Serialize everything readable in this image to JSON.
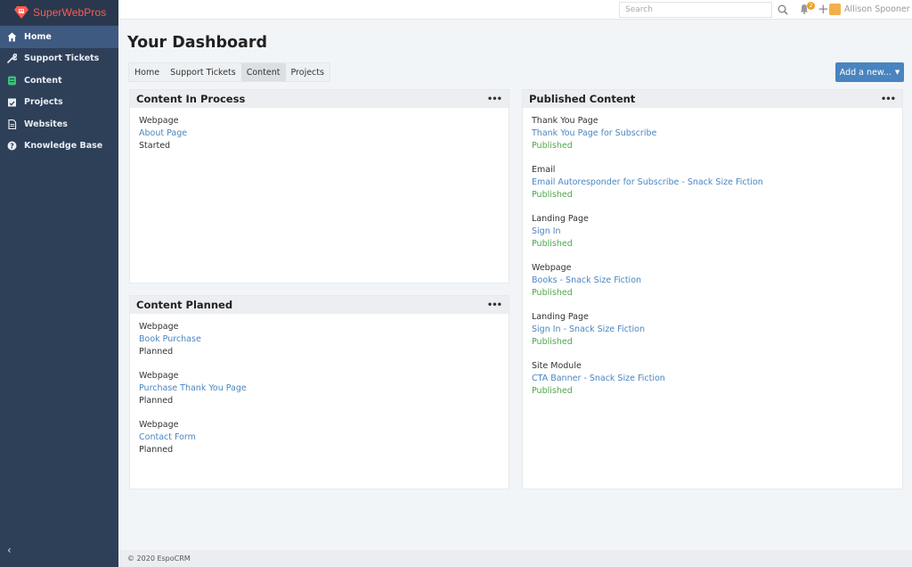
{
  "brand": {
    "name": "SuperWebPros"
  },
  "sidebar": {
    "items": [
      {
        "label": "Home",
        "icon": "home-icon"
      },
      {
        "label": "Support Tickets",
        "icon": "wrench-icon"
      },
      {
        "label": "Content",
        "icon": "content-icon"
      },
      {
        "label": "Projects",
        "icon": "calendar-check-icon"
      },
      {
        "label": "Websites",
        "icon": "document-icon"
      },
      {
        "label": "Knowledge Base",
        "icon": "question-circle-icon"
      }
    ],
    "collapse_glyph": "‹"
  },
  "topbar": {
    "search_placeholder": "Search",
    "notification_count": "2",
    "plus_glyph": "+",
    "user_name": "Allison Spooner"
  },
  "page": {
    "title": "Your Dashboard"
  },
  "tabs": [
    "Home",
    "Support Tickets",
    "Content",
    "Projects"
  ],
  "add_button": {
    "label": "Add a new...",
    "caret": "▼"
  },
  "panels": {
    "in_process": {
      "title": "Content In Process",
      "menu": "•••",
      "records": [
        {
          "type": "Webpage",
          "name": "About Page",
          "status": "Started"
        }
      ]
    },
    "planned": {
      "title": "Content Planned",
      "menu": "•••",
      "records": [
        {
          "type": "Webpage",
          "name": "Book Purchase",
          "status": "Planned"
        },
        {
          "type": "Webpage",
          "name": "Purchase Thank You Page",
          "status": "Planned"
        },
        {
          "type": "Webpage",
          "name": "Contact Form",
          "status": "Planned"
        }
      ]
    },
    "published": {
      "title": "Published Content",
      "menu": "•••",
      "records": [
        {
          "type": "Thank You Page",
          "name": "Thank You Page for Subscribe",
          "status": "Published"
        },
        {
          "type": "Email",
          "name": "Email Autoresponder for Subscribe - Snack Size Fiction",
          "status": "Published"
        },
        {
          "type": "Landing Page",
          "name": "Sign In",
          "status": "Published"
        },
        {
          "type": "Webpage",
          "name": "Books - Snack Size Fiction",
          "status": "Published"
        },
        {
          "type": "Landing Page",
          "name": "Sign In - Snack Size Fiction",
          "status": "Published"
        },
        {
          "type": "Site Module",
          "name": "CTA Banner - Snack Size Fiction",
          "status": "Published"
        }
      ]
    }
  },
  "footer": {
    "text": "© 2020 EspoCRM"
  },
  "colors": {
    "sidebar_bg": "#2e3f58",
    "sidebar_active": "#3f5a80",
    "brand_red": "#ff5a4e",
    "link": "#4a86c1",
    "published_green": "#4fa64b",
    "primary_button": "#4884c0"
  }
}
